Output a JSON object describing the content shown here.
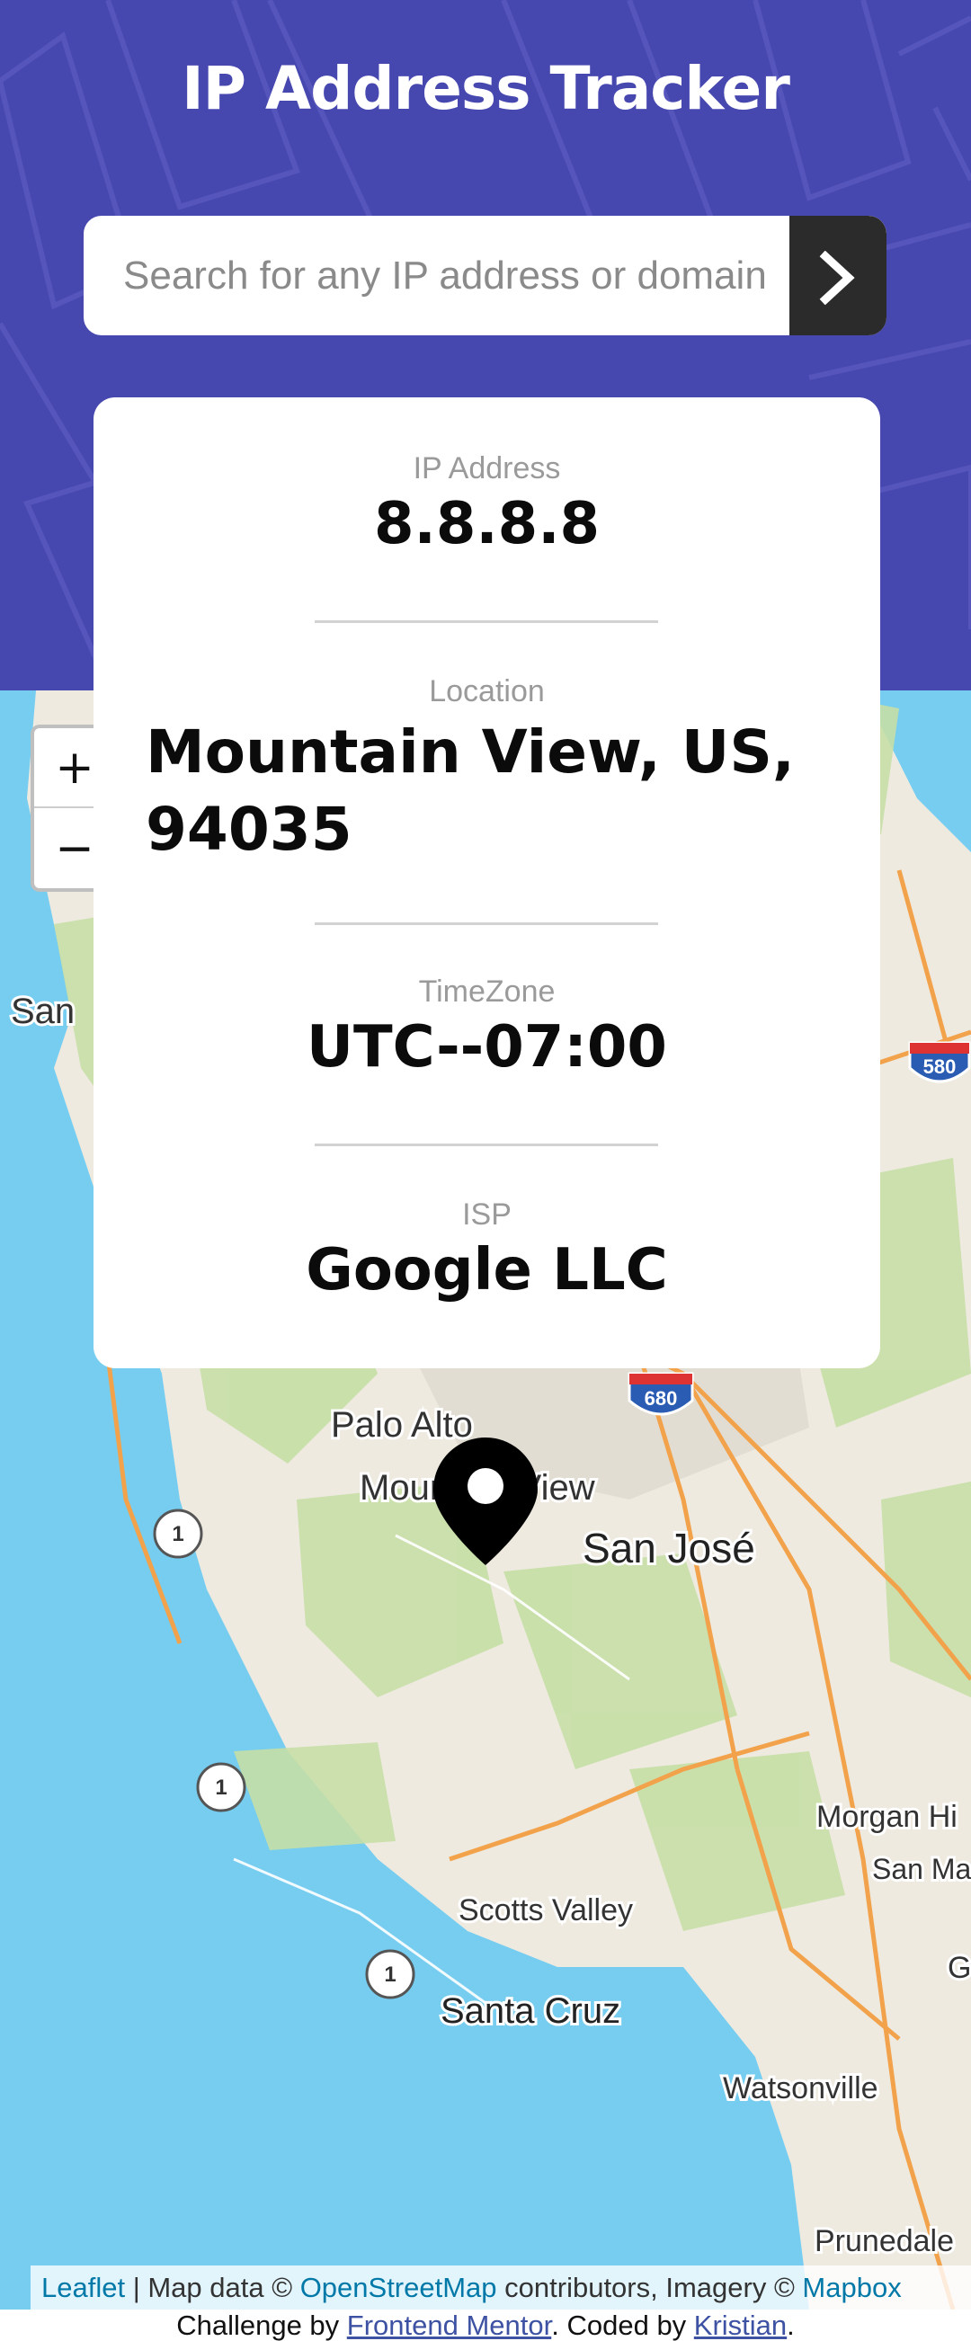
{
  "header": {
    "title": "IP Address Tracker",
    "search_placeholder": "Search for any IP address or domain",
    "search_button_icon": "chevron-right-icon"
  },
  "info": {
    "ip_label": "IP Address",
    "ip_value": "8.8.8.8",
    "location_label": "Location",
    "location_value": "Mountain View, US, 94035",
    "timezone_label": "TimeZone",
    "timezone_value": "UTC--07:00",
    "isp_label": "ISP",
    "isp_value": "Google LLC"
  },
  "map": {
    "zoom_in": "+",
    "zoom_out": "−",
    "labels": {
      "palo_alto": "Palo Alto",
      "mountain_view": "Mountain View",
      "san_jose": "San José",
      "san": "San",
      "morgan_hill": "Morgan Hi",
      "san_ma": "San Ma",
      "scotts_valley": "Scotts Valley",
      "santa_cruz": "Santa Cruz",
      "watsonville": "Watsonville",
      "prunedale": "Prunedale",
      "g": "G",
      "route_1": "1",
      "route_680": "680",
      "route_580": "580"
    }
  },
  "attribution": {
    "leaflet": "Leaflet",
    "sep": " | Map data © ",
    "osm": "OpenStreetMap",
    "mid": " contributors, Imagery © ",
    "mapbox": "Mapbox"
  },
  "footer": {
    "prefix": "Challenge by ",
    "frontend_mentor": "Frontend Mentor",
    "middle": ". Coded by ",
    "author": "Kristian",
    "suffix": "."
  },
  "colors": {
    "header_bg": "#4747b0",
    "water": "#76cdf0",
    "land": "#eeeae0",
    "park": "#c7dfa6",
    "road": "#f2a24b",
    "marker": "#000000"
  }
}
